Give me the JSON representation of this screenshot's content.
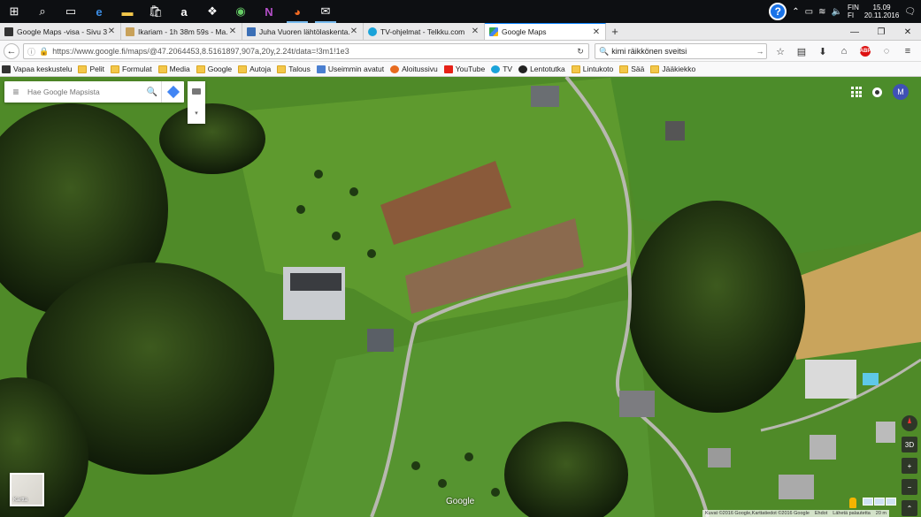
{
  "taskbar": {
    "icons": [
      "windows-start",
      "search",
      "task-view",
      "edge",
      "file-explorer",
      "store",
      "amazon",
      "dropbox",
      "tripadvisor",
      "onenote",
      "firefox",
      "mail"
    ],
    "tray": {
      "language_top": "FIN",
      "language_bottom": "FI",
      "time": "15.09",
      "date": "20.11.2016"
    }
  },
  "tabs": [
    {
      "label": "Google Maps -visa - Sivu 3",
      "color": "#333333",
      "active": false
    },
    {
      "label": "Ikariam - 1h 38m 59s - Ma...",
      "color": "#c9a25a",
      "active": false
    },
    {
      "label": "Juha Vuoren lähtölaskenta...",
      "color": "#3b6fb6",
      "active": false
    },
    {
      "label": "TV-ohjelmat - Telkku.com",
      "color": "#1aa3d9",
      "active": false
    },
    {
      "label": "Google Maps",
      "color": "#34a853",
      "active": true
    }
  ],
  "navbar": {
    "url": "https://www.google.fi/maps/@47.2064453,8.5161897,907a,20y,2.24t/data=!3m1!1e3",
    "search_value": "kimi räikkönen sveitsi"
  },
  "bookmarks": [
    {
      "label": "Vapaa keskustelu",
      "type": "site",
      "color": "#333333"
    },
    {
      "label": "Pelit",
      "type": "folder"
    },
    {
      "label": "Formulat",
      "type": "folder"
    },
    {
      "label": "Media",
      "type": "folder"
    },
    {
      "label": "Google",
      "type": "folder"
    },
    {
      "label": "Autoja",
      "type": "folder"
    },
    {
      "label": "Talous",
      "type": "folder"
    },
    {
      "label": "Useimmin avatut",
      "type": "site",
      "color": "#4a7fd0"
    },
    {
      "label": "Aloitussivu",
      "type": "site",
      "color": "#e76b1f"
    },
    {
      "label": "YouTube",
      "type": "site",
      "color": "#e62117"
    },
    {
      "label": "TV",
      "type": "site",
      "color": "#1aa3d9"
    },
    {
      "label": "Lentotutka",
      "type": "site",
      "color": "#222222"
    },
    {
      "label": "Lintukoto",
      "type": "folder"
    },
    {
      "label": "Sää",
      "type": "folder"
    },
    {
      "label": "Jääkiekko",
      "type": "folder"
    }
  ],
  "maps": {
    "search_placeholder": "Hae Google Mapsista",
    "avatar_letter": "M",
    "minimap_label": "Kartta",
    "logo": "Google",
    "tilt_label": "3D",
    "footer": [
      "Kuvat ©2016 Google,Karttatiedot ©2016 Google",
      "Ehdot",
      "Lähetä palautetta",
      "20 m"
    ]
  }
}
